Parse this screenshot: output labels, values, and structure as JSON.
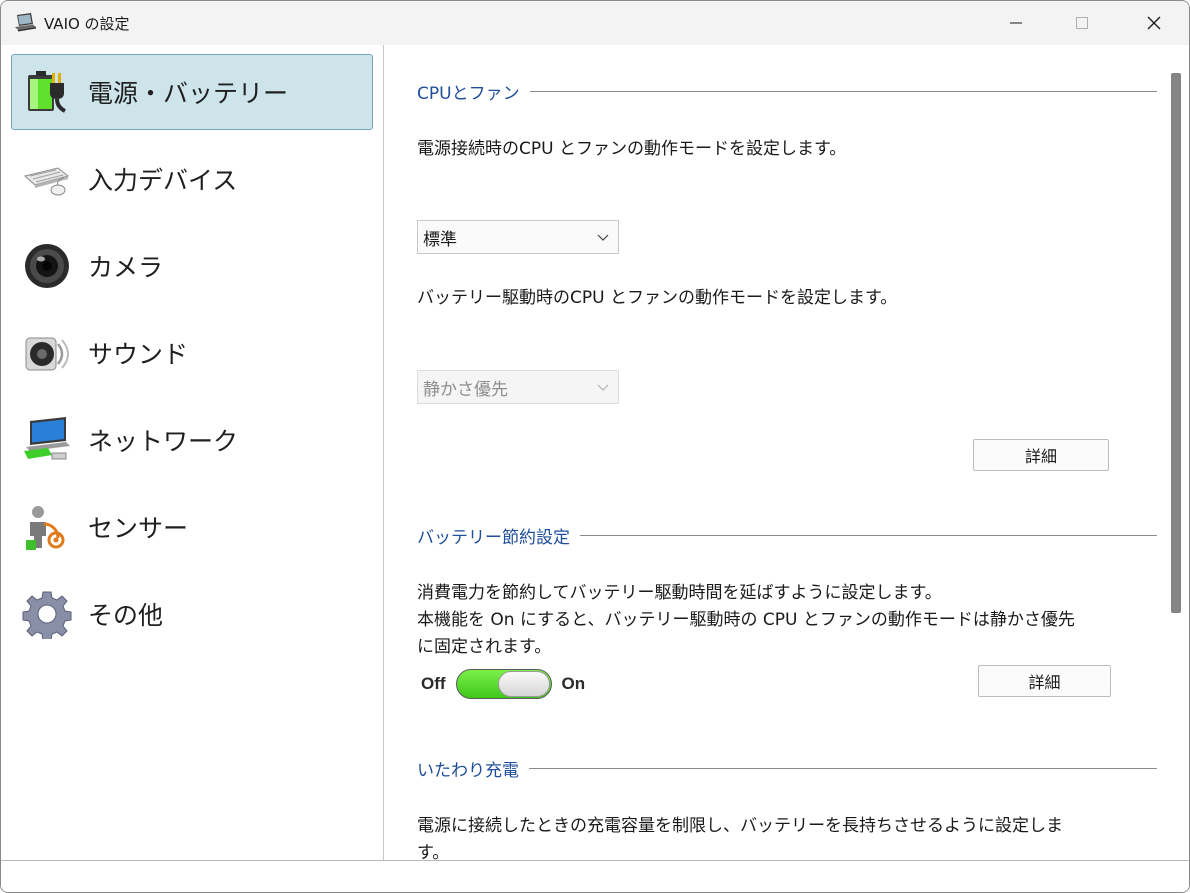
{
  "window": {
    "title": "VAIO の設定"
  },
  "sidebar": {
    "items": [
      {
        "label": "電源・バッテリー",
        "icon": "battery-plug-icon",
        "selected": true
      },
      {
        "label": "入力デバイス",
        "icon": "keyboard-mouse-icon",
        "selected": false
      },
      {
        "label": "カメラ",
        "icon": "camera-lens-icon",
        "selected": false
      },
      {
        "label": "サウンド",
        "icon": "speaker-icon",
        "selected": false
      },
      {
        "label": "ネットワーク",
        "icon": "network-laptop-icon",
        "selected": false
      },
      {
        "label": "センサー",
        "icon": "sensor-person-icon",
        "selected": false
      },
      {
        "label": "その他",
        "icon": "gear-icon",
        "selected": false
      }
    ]
  },
  "content": {
    "cpu_fan": {
      "title": "CPUとファン",
      "ac_desc": "電源接続時のCPU とファンの動作モードを設定します。",
      "ac_mode": "標準",
      "battery_desc": "バッテリー駆動時のCPU とファンの動作モードを設定します。",
      "battery_mode": "静かさ優先",
      "details_label": "詳細"
    },
    "battery_saver": {
      "title": "バッテリー節約設定",
      "desc_line1": "消費電力を節約してバッテリー駆動時間を延ばすように設定します。",
      "desc_line2": "本機能を On にすると、バッテリー駆動時の CPU とファンの動作モードは静かさ優先",
      "desc_line3": "に固定されます。",
      "toggle_off_label": "Off",
      "toggle_on_label": "On",
      "toggle_state": "on",
      "details_label": "詳細"
    },
    "care_charge": {
      "title": "いたわり充電",
      "desc_line1": "電源に接続したときの充電容量を制限し、バッテリーを長持ちさせるように設定しま",
      "desc_line2": "す。"
    }
  },
  "colors": {
    "section_title": "#1f4f9a",
    "selected_bg": "#cde4ea",
    "toggle_on": "#3ec81a"
  }
}
